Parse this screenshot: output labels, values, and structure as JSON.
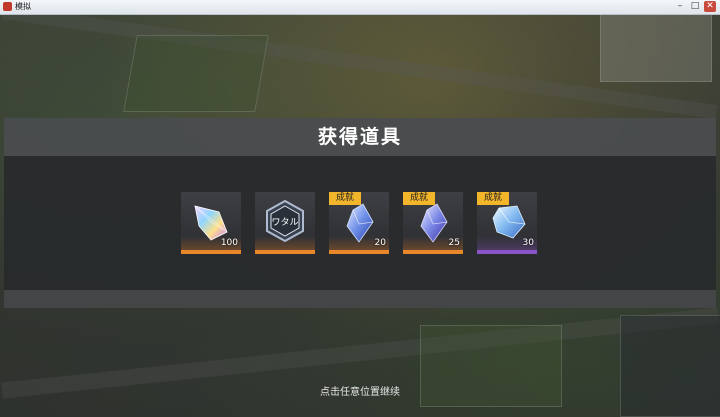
{
  "window": {
    "title": "模拟"
  },
  "dialog": {
    "title": "获得道具"
  },
  "items": [
    {
      "icon": "rainbow-crystal-icon",
      "count": "100",
      "badge": "",
      "bar_color": "#e8872a"
    },
    {
      "icon": "hexagon-emblem-icon",
      "count": "",
      "badge": "",
      "bar_color": "#e8872a"
    },
    {
      "icon": "blue-crystal-icon",
      "count": "20",
      "badge": "成就",
      "bar_color": "#e8872a"
    },
    {
      "icon": "blue-crystal-icon",
      "count": "25",
      "badge": "成就",
      "bar_color": "#e8872a"
    },
    {
      "icon": "blue-crystal-chunk-icon",
      "count": "30",
      "badge": "成就",
      "bar_color": "#8a55c8"
    }
  ],
  "hint": "点击任意位置继续",
  "emblem_text": "ワタル"
}
